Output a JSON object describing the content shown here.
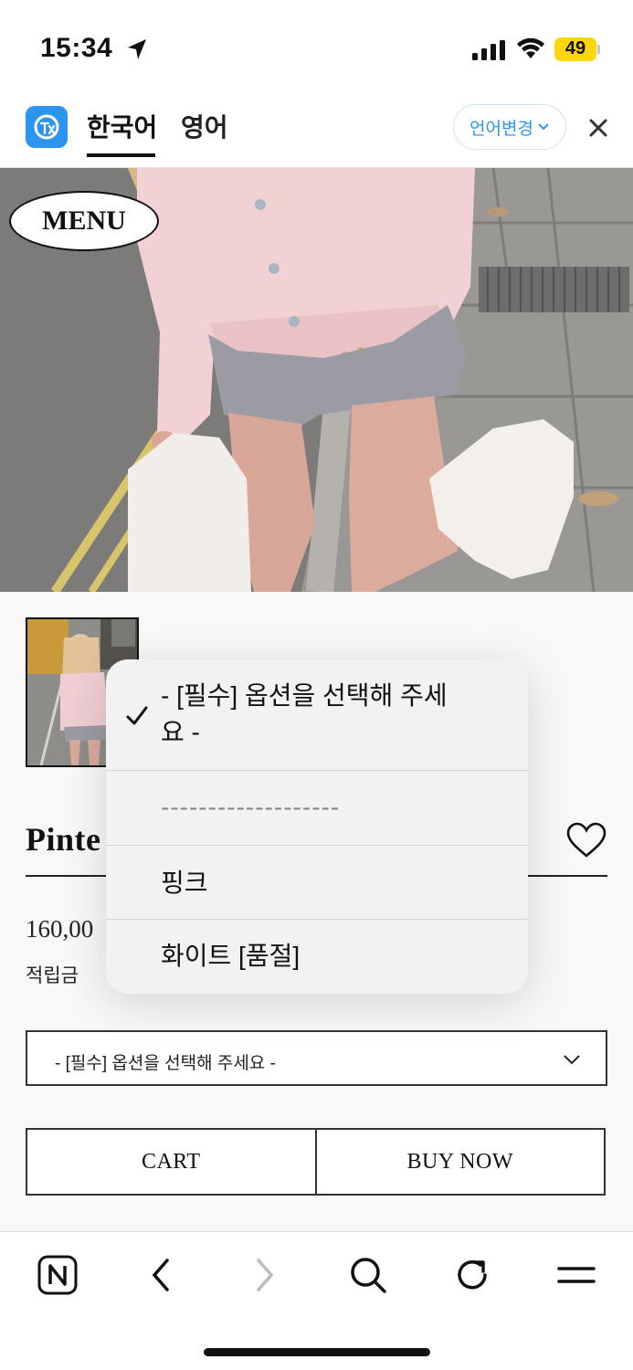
{
  "status_bar": {
    "time": "15:34",
    "battery": "49",
    "battery_color": "#ffd60a"
  },
  "translate_bar": {
    "tab_korean": "한국어",
    "tab_english": "영어",
    "lang_change_label": "언어변경",
    "accent_color": "#2b95f0"
  },
  "hero": {
    "menu_label": "MENU"
  },
  "product": {
    "title": "Pinte",
    "price": "160,00",
    "points_label": "적립금",
    "select_value": "- [필수] 옵션을 선택해 주세요 -",
    "cart_label": "CART",
    "buy_now_label": "BUY NOW"
  },
  "dropdown": {
    "options": [
      {
        "label": "- [필수] 옵션을 선택해 주세요 -",
        "selected": true
      },
      {
        "label": "-------------------",
        "selected": false
      },
      {
        "label": "핑크",
        "selected": false
      },
      {
        "label": "화이트 [품절]",
        "selected": false
      }
    ]
  },
  "toolbar": {
    "icons": [
      "naver-n-icon",
      "back-icon",
      "forward-icon",
      "search-icon",
      "reload-icon",
      "menu-icon"
    ]
  }
}
